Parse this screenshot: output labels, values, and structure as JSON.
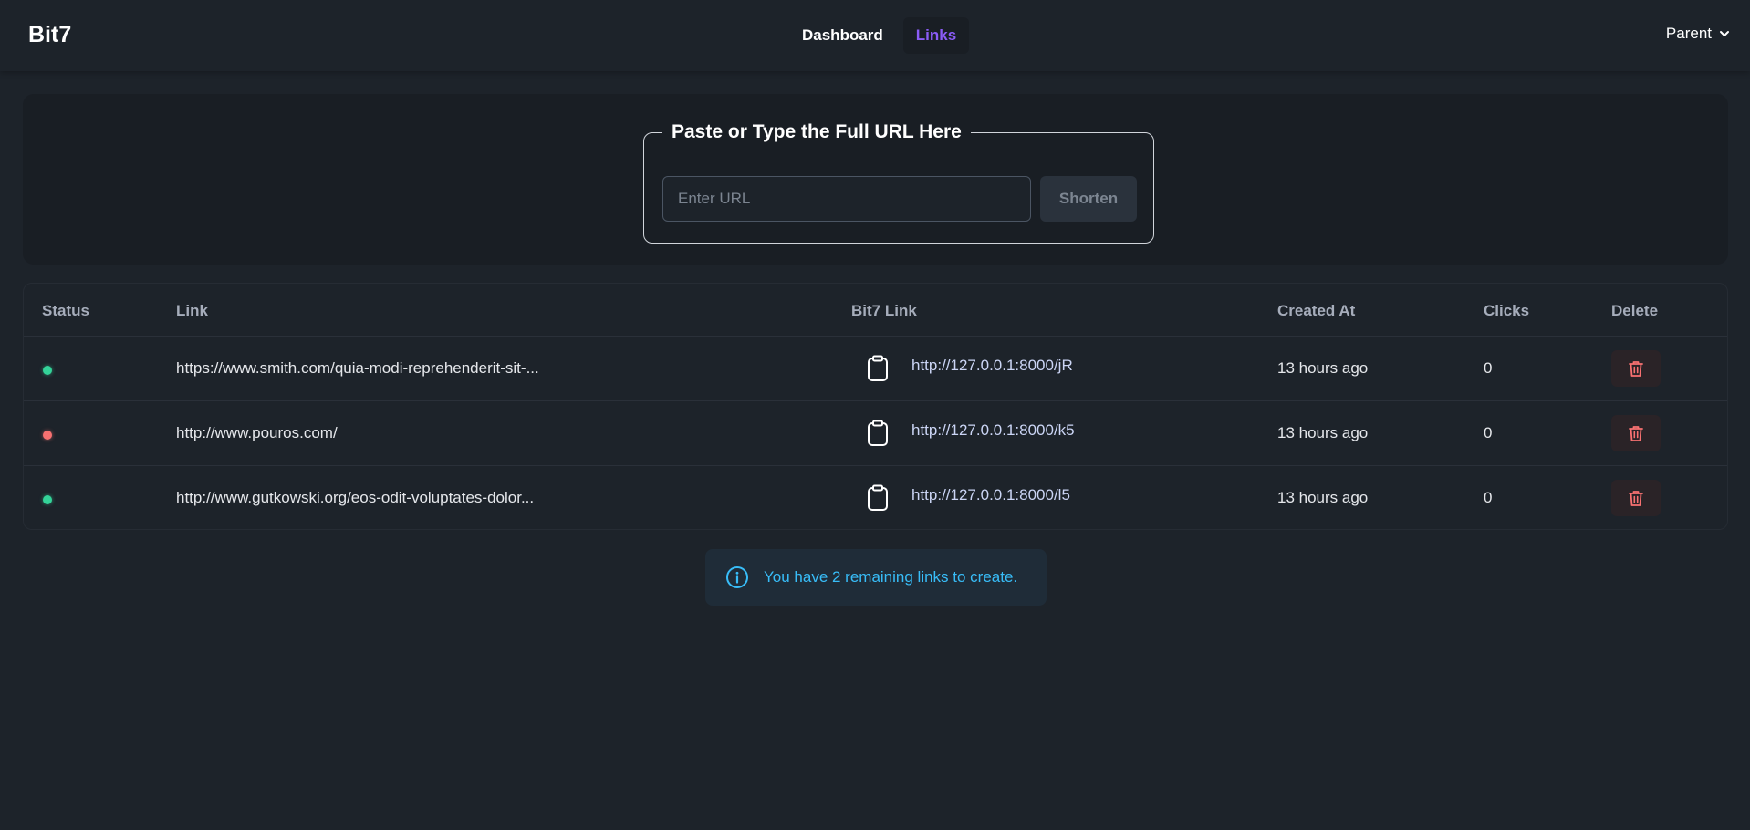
{
  "navbar": {
    "brand": "Bit7",
    "links": [
      {
        "label": "Dashboard",
        "active": false
      },
      {
        "label": "Links",
        "active": true
      }
    ],
    "user": "Parent",
    "user_icon": "chevron-down-icon"
  },
  "url_form": {
    "legend": "Paste or Type the Full URL Here",
    "placeholder": "Enter URL",
    "value": "",
    "button_label": "Shorten"
  },
  "table": {
    "headers": {
      "status": "Status",
      "link": "Link",
      "bit7_link": "Bit7 Link",
      "created_at": "Created At",
      "clicks": "Clicks",
      "delete": "Delete"
    },
    "rows": [
      {
        "status": "active",
        "link": "https://www.smith.com/quia-modi-reprehenderit-sit-...",
        "bit7_link": "http://127.0.0.1:8000/jR",
        "created_at": "13 hours ago",
        "clicks": "0"
      },
      {
        "status": "inactive",
        "link": "http://www.pouros.com/",
        "bit7_link": "http://127.0.0.1:8000/k5",
        "created_at": "13 hours ago",
        "clicks": "0"
      },
      {
        "status": "active",
        "link": "http://www.gutkowski.org/eos-odit-voluptates-dolor...",
        "bit7_link": "http://127.0.0.1:8000/l5",
        "created_at": "13 hours ago",
        "clicks": "0"
      }
    ]
  },
  "alert": {
    "icon": "info-icon",
    "text": "You have 2 remaining links to create."
  },
  "colors": {
    "accent": "#8b5cf6",
    "status_active": "#34d399",
    "status_inactive": "#f87171",
    "info": "#38bdf8",
    "danger": "#f87171"
  }
}
